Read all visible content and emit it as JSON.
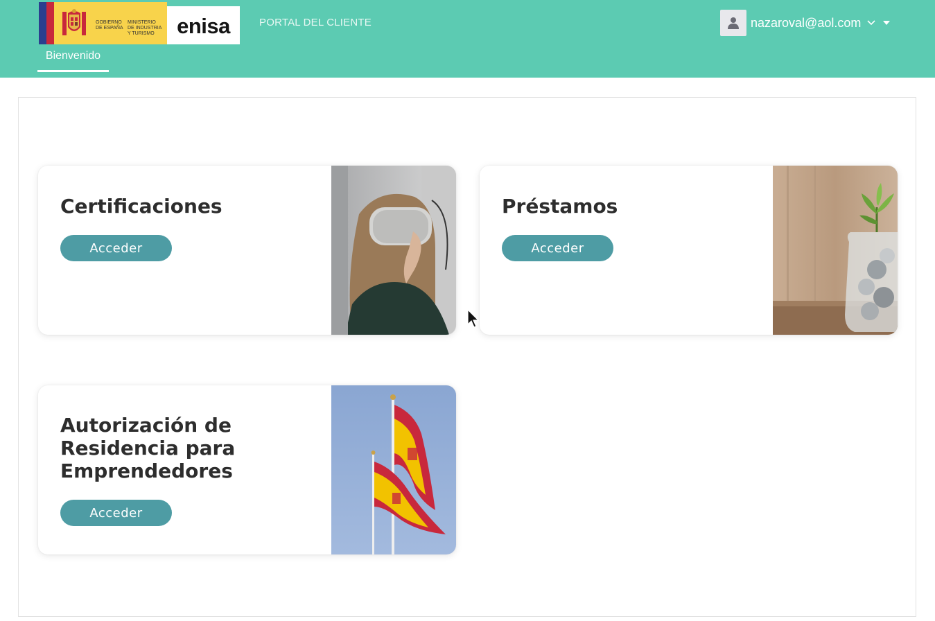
{
  "header": {
    "logo_gov_line1": "GOBIERNO",
    "logo_gov_line2": "DE ESPAÑA",
    "logo_min_line1": "MINISTERIO",
    "logo_min_line2": "DE INDUSTRIA",
    "logo_min_line3": "Y TURISMO",
    "logo_brand": "enisa",
    "portal_title": "PORTAL DEL CLIENTE",
    "user_email": "nazaroval@aol.com",
    "tab_welcome": "Bienvenido"
  },
  "cards": [
    {
      "title": "Certificaciones",
      "button": "Acceder",
      "image": "woman-vr-headset-photo"
    },
    {
      "title": "Préstamos",
      "button": "Acceder",
      "image": "coin-jar-plant-photo"
    },
    {
      "title": "Autorización de Residencia para Emprendedores",
      "button": "Acceder",
      "image": "spanish-flags-photo"
    }
  ],
  "colors": {
    "header_bg": "#5ccbb2",
    "button_bg": "#4e9ca4",
    "title_text": "#2d2d2d"
  },
  "icons": [
    "user-icon",
    "chevron-down-icon",
    "caret-down-icon",
    "mouse-cursor-icon"
  ]
}
